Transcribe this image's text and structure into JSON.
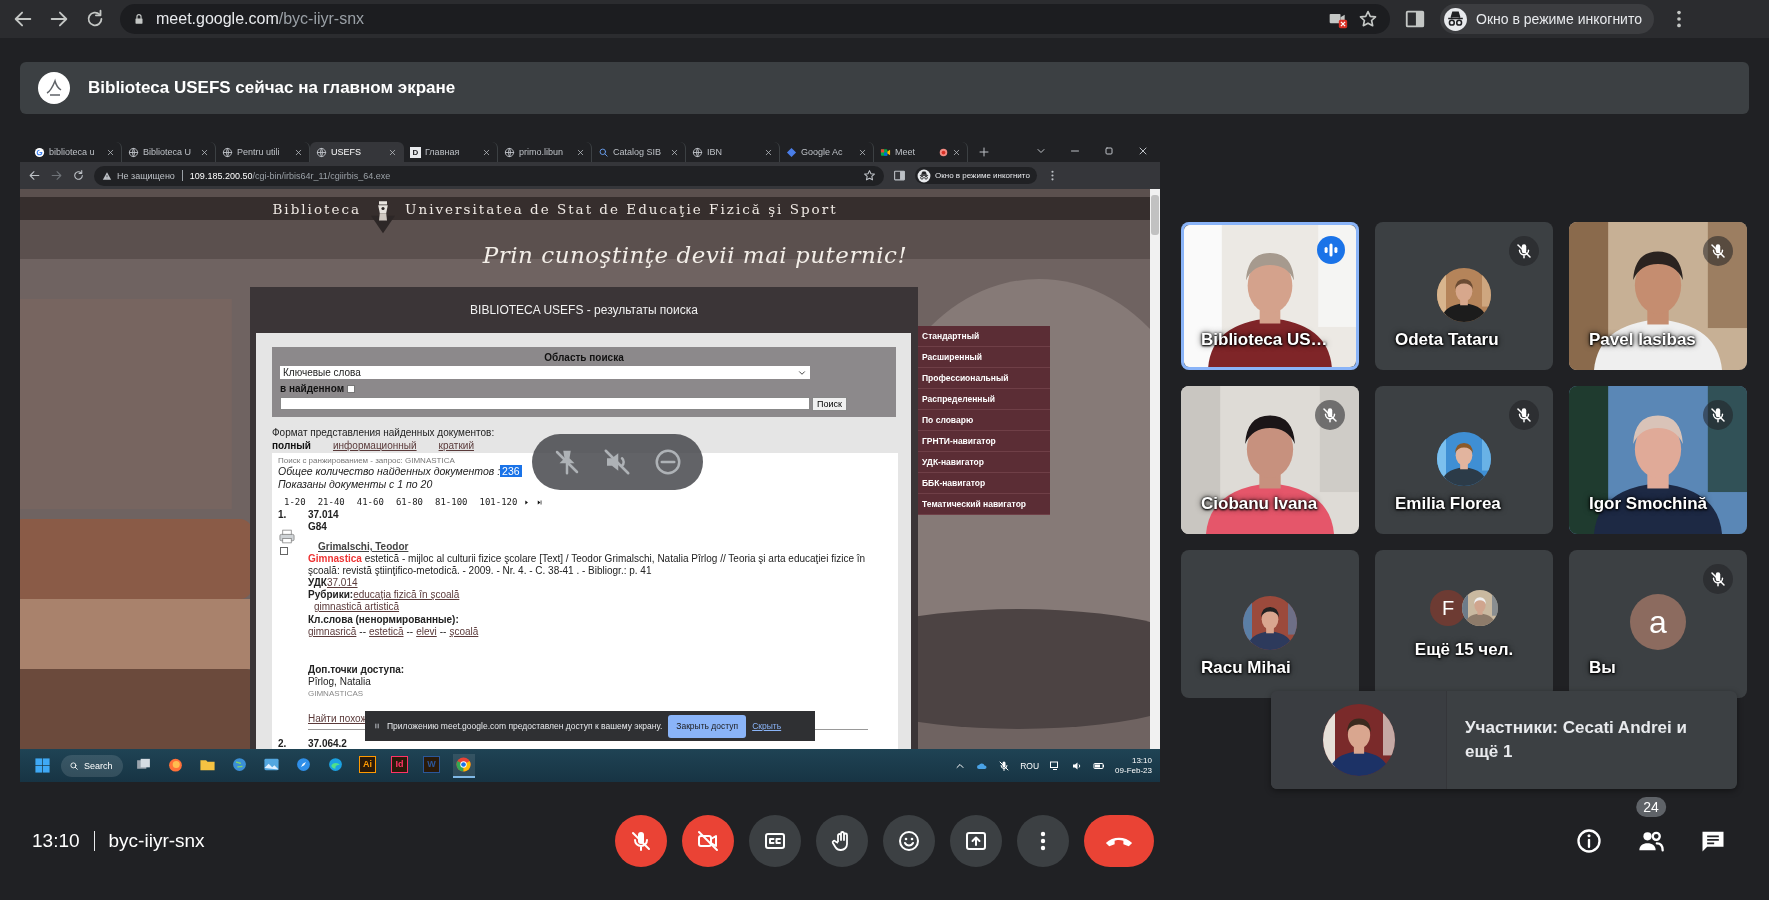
{
  "browser": {
    "url_host": "meet.google.com",
    "url_path": "/byc-iiyr-snx",
    "incognito_label": "Окно в режиме инкогнито"
  },
  "presentation_banner": {
    "text": "Biblioteca USEFS сейчас на главном экране"
  },
  "shared_screen": {
    "tabs": [
      {
        "title": "biblioteca u",
        "kind": "google",
        "selected": false,
        "recording": false
      },
      {
        "title": "Biblioteca U",
        "kind": "globe",
        "selected": false,
        "recording": false
      },
      {
        "title": "Pentru utili",
        "kind": "globe",
        "selected": false,
        "recording": false
      },
      {
        "title": "USEFS",
        "kind": "globe",
        "selected": true,
        "recording": false
      },
      {
        "title": "Главная",
        "kind": "letter",
        "letter": "D",
        "selected": false,
        "recording": false
      },
      {
        "title": "primo.libun",
        "kind": "globe",
        "selected": false,
        "recording": false
      },
      {
        "title": "Catalog SIB",
        "kind": "search",
        "selected": false,
        "recording": false
      },
      {
        "title": "IBN",
        "kind": "globe",
        "selected": false,
        "recording": false
      },
      {
        "title": "Google Ac",
        "kind": "diamond",
        "selected": false,
        "recording": false
      },
      {
        "title": "Meet",
        "kind": "meet",
        "selected": false,
        "recording": true
      }
    ],
    "address": {
      "security": "Не защищено",
      "host": "109.185.200.50",
      "path": "/cgi-bin/irbis64r_11/cgiirbis_64.exe",
      "incognito_label": "Окно в режиме инкогнито"
    },
    "site": {
      "brand": "Biblioteca",
      "university": "Universitatea de Stat de Educaţie Fizică şi Sport",
      "tagline": "Prin cunoştinţe devii mai puternic!"
    },
    "panel_title": "BIBLIOTECA USEFS - результаты поиска",
    "search": {
      "area_label": "Область поиска",
      "area_value": "Ключевые слова",
      "in_found_label": "в найденном",
      "in_found_checked": false,
      "button": "Поиск"
    },
    "format": {
      "label": "Формат представления найденных документов:",
      "options": [
        {
          "label": "полный",
          "selected": true
        },
        {
          "label": "информационный",
          "selected": false
        },
        {
          "label": "краткий",
          "selected": false
        }
      ]
    },
    "query_note": "Поиск с ранжированием - запрос: GIMNASTICA",
    "total_label": "Общее количество найденных документов :",
    "total": "236",
    "shown_label": "Показаны документы с 1 по 20",
    "pages": [
      "1-20",
      "21-40",
      "41-60",
      "61-80",
      "81-100",
      "101-120"
    ],
    "records": [
      {
        "number": "1.",
        "udc": "37.014",
        "cutter": "G84",
        "checked": false,
        "author": "Grimalschi, Teodor",
        "highlight": "Gimnastica",
        "description": "estetică - mijloc al culturii fizice şcolare [Text] / Teodor Grimalschi, Natalia Pîrlog // Teoria şi arta educaţiei fizice în şcoală: revistă ştiinţifico-metodică. - 2009. - Nr. 4. - С. 38-41 . - Bibliogr.: p. 41",
        "udk_label": "УДК",
        "udk_link": "37.014",
        "rubrics_label": "Рубрики:",
        "rubrics": [
          "educaţia fizică în şcoală",
          "gimnastică artistică"
        ],
        "keywords_label": "Кл.слова (ненормированные):",
        "keywords": [
          "gimnasrică",
          "estetică",
          "elevi",
          "şcoală"
        ],
        "keyword_separator": "--",
        "access_label": "Доп.точки доступа:",
        "access_name": "Pîrlog, Natalia",
        "access_note": "GIMNASTICAS",
        "similar_link": "Найти похож"
      },
      {
        "number": "2.",
        "udc": "37.064.2"
      }
    ],
    "menu": [
      "Стандартный",
      "Расширенный",
      "Профессиональный",
      "Распределенный",
      "По словарю",
      "ГРНТИ-навигатор",
      "УДК-навигатор",
      "ББК-навигатор",
      "Тематический навигатор"
    ],
    "share_notice": {
      "text": "Приложению meet.google.com предоставлен доступ к вашему экрану.",
      "stop": "Закрыть доступ",
      "hide": "Скрыть"
    },
    "taskbar": {
      "search": "Search",
      "apps": [
        {
          "kind": "taskview",
          "active": false
        },
        {
          "kind": "fox",
          "active": false
        },
        {
          "kind": "folder",
          "active": false
        },
        {
          "kind": "globe",
          "active": false
        },
        {
          "kind": "photos",
          "active": false
        },
        {
          "kind": "compass",
          "active": false
        },
        {
          "kind": "edge",
          "active": false
        },
        {
          "kind": "letter",
          "label": "Ai",
          "color": "#ff9a00",
          "active": false
        },
        {
          "kind": "letter",
          "label": "Id",
          "color": "#ff3366",
          "active": false
        },
        {
          "kind": "letter",
          "label": "W",
          "color": "#2b579a",
          "active": false
        },
        {
          "kind": "chrome",
          "active": true
        }
      ],
      "lang": "ROU",
      "time": "13:10",
      "date": "09-Feb-23"
    }
  },
  "participants": [
    {
      "name": "Biblioteca US…",
      "kind": "video",
      "muted": false,
      "speaking": true
    },
    {
      "name": "Odeta Tataru",
      "muted": true,
      "speaking": false
    },
    {
      "name": "Pavel Iasibas",
      "kind": "video",
      "muted": true,
      "speaking": false
    },
    {
      "name": "Ciobanu Ivana",
      "kind": "video",
      "muted": true,
      "speaking": false
    },
    {
      "name": "Emilia Florea",
      "muted": true,
      "speaking": false
    },
    {
      "name": "Igor Smochină",
      "kind": "video",
      "muted": true,
      "speaking": false
    },
    {
      "name": "Racu Mihai",
      "muted": false,
      "speaking": false
    },
    {
      "name": "Ещё 15 чел.",
      "kind": "more",
      "initial": "F"
    },
    {
      "name": "Вы",
      "kind": "letter",
      "initial": "a",
      "muted": true,
      "speaking": false
    }
  ],
  "toast": {
    "text": "Участники: Cecati Andrei и ещё 1"
  },
  "meeting": {
    "time": "13:10",
    "code": "byc-iiyr-snx"
  },
  "controls": [
    {
      "kind": "mic",
      "off": true
    },
    {
      "kind": "camera",
      "off": true
    },
    {
      "kind": "captions"
    },
    {
      "kind": "hand"
    },
    {
      "kind": "emoji"
    },
    {
      "kind": "present"
    },
    {
      "kind": "more"
    },
    {
      "kind": "end"
    }
  ],
  "people_count": "24"
}
